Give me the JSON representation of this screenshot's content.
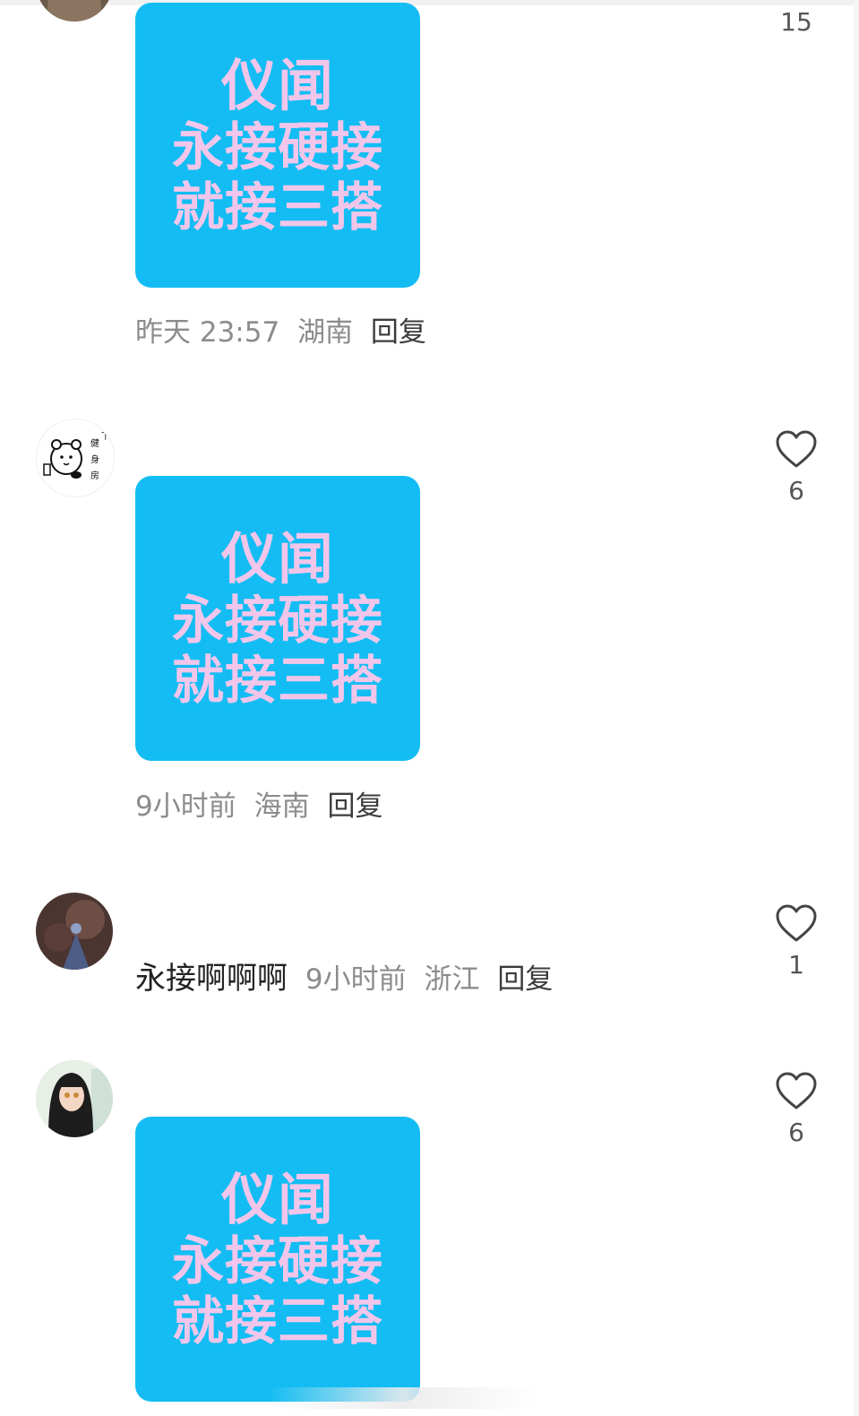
{
  "sticker": {
    "line1": "仪闻",
    "line2": "永接硬接",
    "line3": "就接三搭",
    "bg_color": "#13bdf3",
    "text_color": "#f2c6ea"
  },
  "comments": [
    {
      "time": "昨天 23:57",
      "location": "湖南",
      "reply_label": "回复",
      "like_count": "15"
    },
    {
      "time": "9小时前",
      "location": "海南",
      "reply_label": "回复",
      "like_count": "6",
      "avatar_text": [
        "健",
        "身",
        "房",
        "下"
      ]
    },
    {
      "content": "永接啊啊啊",
      "time": "9小时前",
      "location": "浙江",
      "reply_label": "回复",
      "like_count": "1"
    },
    {
      "like_count": "6"
    }
  ],
  "icons": {
    "like": "heart-outline-icon"
  }
}
